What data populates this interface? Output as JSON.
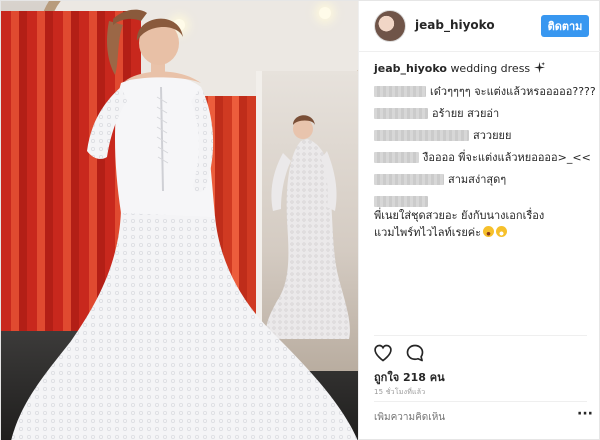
{
  "post": {
    "username": "jeab_hiyoko",
    "follow_label": "ติดตาม",
    "caption_username": "jeab_hiyoko",
    "caption_text": "wedding dress",
    "caption_icon": "sparkles-icon",
    "comments": [
      {
        "text": "เด๋วๆๆๆๆ จะแต่งแล้วหรอออออ????"
      },
      {
        "text": "อร้ายย สวยอ่า"
      },
      {
        "text": "สววยยย"
      },
      {
        "text": "งืออออ พี่จะแต่งแล้วหยออออ>_<<"
      },
      {
        "text": "สามสง่าสุดๆ"
      },
      {
        "text": "พี่เนยใส่ชุดสวยอะ ยังกับนางเอกเรื่อง",
        "text2": "แวมไพร์ทไวไลท์เรยค่ะ"
      }
    ],
    "likes_text": "ถูกใจ 218 คน",
    "timestamp": "15 ชั่วโมงที่แล้ว",
    "add_comment_placeholder": "เพิ่มความคิดเห็น",
    "more_label": "···"
  },
  "icons": {
    "like": "heart-icon",
    "comment": "comment-bubble-icon",
    "more": "more-options-icon"
  },
  "colors": {
    "follow_button": "#3897f0",
    "curtain": "#d9381e",
    "secondary_text": "#999999"
  }
}
